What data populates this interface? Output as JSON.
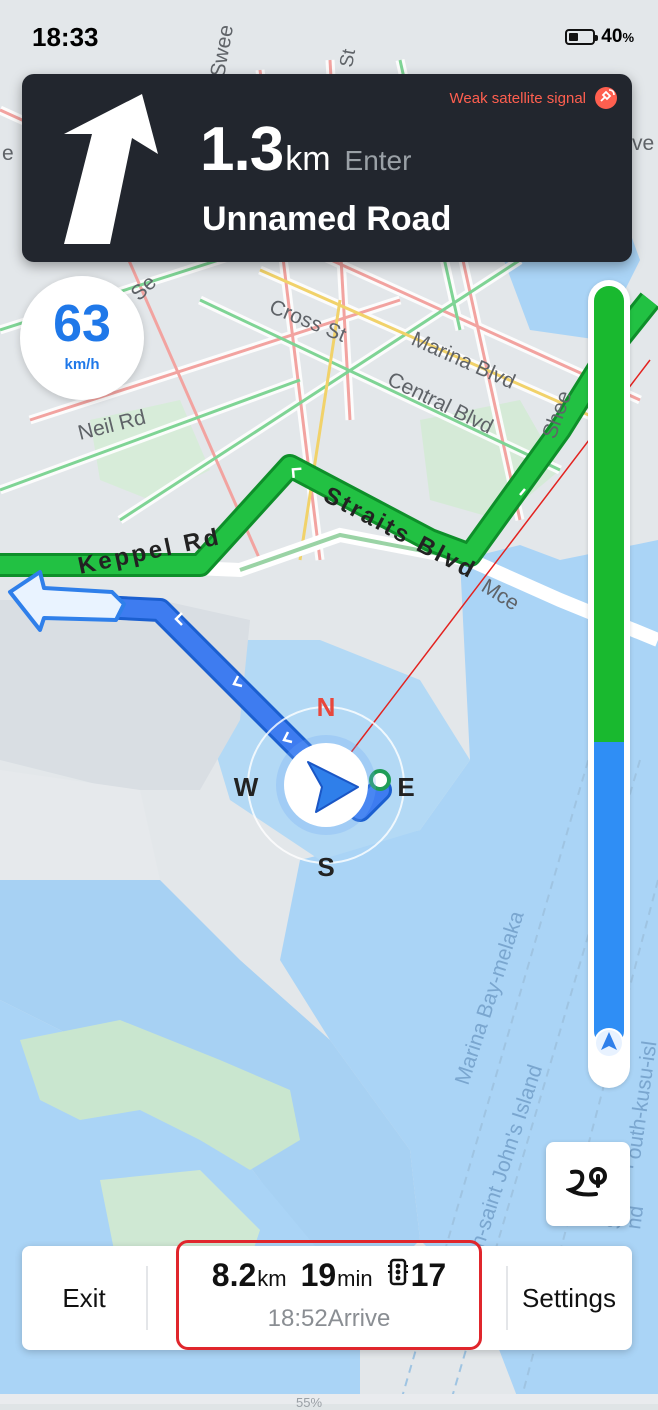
{
  "status": {
    "time": "18:33",
    "battery_pct": "40",
    "battery_unit": "%"
  },
  "nav": {
    "distance": "1.3",
    "distance_unit": "km",
    "action": "Enter",
    "road": "Unnamed Road",
    "signal_warning": "Weak satellite signal",
    "turn_icon": "turn-slight-right-arrow"
  },
  "speed": {
    "value": "63",
    "unit": "km/h"
  },
  "map_labels": {
    "keppel": "Keppel Rd",
    "straits": "Straits Blvd",
    "cross": "Cross St",
    "marina": "Marina Blvd",
    "central": "Central Blvd",
    "neil": "Neil Rd",
    "mce": "Mce",
    "she": "Shee",
    "sweet": "Swee",
    "ngse": "ng Se",
    "bay": "Marina Bay-melaka",
    "stjohn": "South-saint John's Island",
    "kusu": "outh-kusu-isl",
    "south2": "South-p",
    "island": "nd",
    "e_left": "e",
    "v_right": "ve",
    "st": "St"
  },
  "compass": {
    "n": "N",
    "e": "E",
    "s": "S",
    "w": "W"
  },
  "progress": {
    "completed_fraction": 0.6
  },
  "bottom": {
    "exit": "Exit",
    "settings": "Settings",
    "distance": "8.2",
    "distance_unit": "km",
    "time": "19",
    "time_unit": "min",
    "lights": "17",
    "arrive_time": "18:52",
    "arrive_label": "Arrive",
    "strip_text": "55%"
  },
  "colors": {
    "route_green": "#19b92f",
    "route_blue": "#2f8ef5",
    "highlight": "#e0262c",
    "warning": "#ff5f4f"
  },
  "icons": [
    "satellite-icon",
    "route-options-icon",
    "traffic-light-icon",
    "nav-arrow-icon",
    "battery-icon"
  ]
}
